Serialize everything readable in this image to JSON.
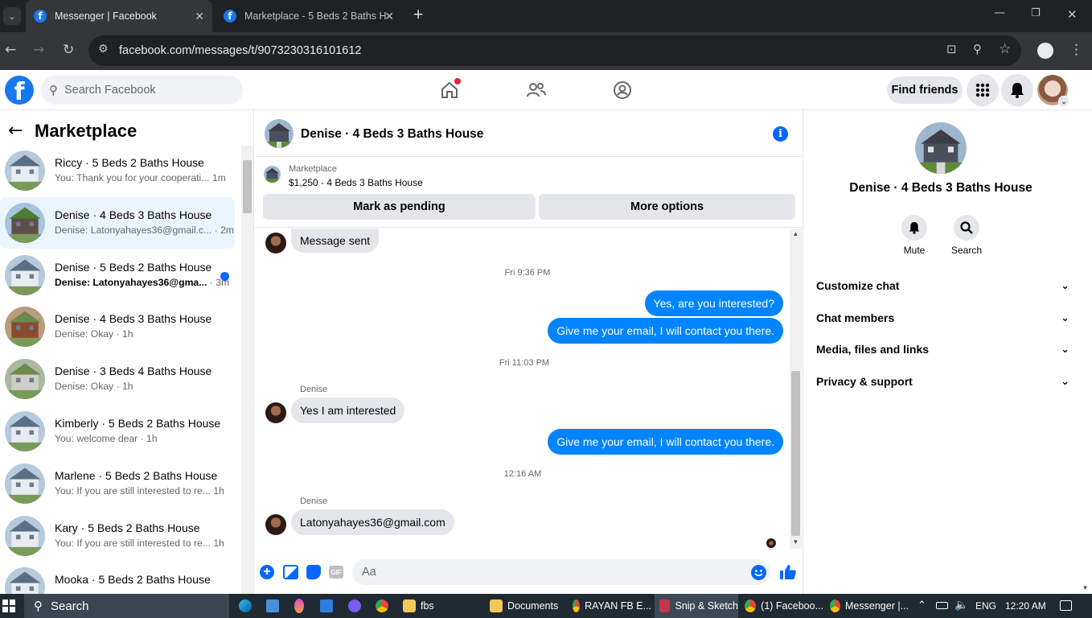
{
  "browser": {
    "tabs": [
      {
        "title": "Messenger | Facebook",
        "active": true
      },
      {
        "title": "Marketplace - 5 Beds 2 Baths H",
        "active": false
      }
    ],
    "url": "facebook.com/messages/t/9073230316101612"
  },
  "fb_header": {
    "search_placeholder": "Search Facebook",
    "find_friends": "Find friends"
  },
  "sidebar": {
    "title": "Marketplace",
    "conversations": [
      {
        "name": "Riccy · 5 Beds 2 Baths House",
        "preview": "You: Thank you for your cooperati...",
        "time": "1m",
        "unread": false,
        "selected": false
      },
      {
        "name": "Denise · 4 Beds 3 Baths House",
        "preview": "Denise: Latonyahayes36@gmail.c...",
        "time": "· 2m",
        "unread": false,
        "selected": true
      },
      {
        "name": "Denise · 5 Beds 2 Baths House",
        "preview": "Denise: Latonyahayes36@gma...",
        "time": "· 3m",
        "unread": true,
        "selected": false
      },
      {
        "name": "Denise · 4 Beds 3 Baths House",
        "preview": "Denise: Okay",
        "time": "· 1h",
        "unread": false,
        "selected": false
      },
      {
        "name": "Denise · 3 Beds 4 Baths House",
        "preview": "Denise: Okay",
        "time": "· 1h",
        "unread": false,
        "selected": false
      },
      {
        "name": "Kimberly · 5 Beds 2 Baths House",
        "preview": "You: welcome dear",
        "time": "· 1h",
        "unread": false,
        "selected": false
      },
      {
        "name": "Marlene · 5 Beds 2 Baths House",
        "preview": "You: If you are still interested to re...",
        "time": "1h",
        "unread": false,
        "selected": false
      },
      {
        "name": "Kary · 5 Beds 2 Baths House",
        "preview": "You: If you are still interested to re...",
        "time": "1h",
        "unread": false,
        "selected": false
      },
      {
        "name": "Mooka · 5 Beds 2 Baths House",
        "preview": "",
        "time": "",
        "unread": false,
        "selected": false
      }
    ]
  },
  "chat": {
    "title": "Denise · 4 Beds 3 Baths House",
    "listing": {
      "label": "Marketplace",
      "price_title": "$1,250 - 4 Beds 3 Baths House"
    },
    "actions": {
      "pending": "Mark as pending",
      "more": "More options"
    },
    "messages": {
      "m1": "Message sent",
      "ts1": "Fri 9:36 PM",
      "m2": "Yes, are you interested?",
      "m3": "Give me your email, I will contact you there.",
      "ts2": "Fri 11:03 PM",
      "sender1": "Denise",
      "m4": "Yes I am interested",
      "m5": "Give me your email, I will contact you there.",
      "ts3": "12:16 AM",
      "sender2": "Denise",
      "m6": "Latonyahayes36@gmail.com"
    },
    "composer_placeholder": "Aa",
    "gif_label": "GIF"
  },
  "details": {
    "name": "Denise · 4 Beds 3 Baths House",
    "mute": "Mute",
    "search": "Search",
    "sections": [
      "Customize chat",
      "Chat members",
      "Media, files and links",
      "Privacy & support"
    ]
  },
  "taskbar": {
    "search": "Search",
    "apps": [
      "fbs",
      "Documents",
      "RAYAN FB E...",
      "Snip & Sketch",
      "(1) Faceboo...",
      "Messenger |..."
    ],
    "lang": "ENG",
    "time": "12:20 AM"
  },
  "colors": {
    "fb_blue": "#1877f2",
    "bubble_out": "#0084ff",
    "bubble_in": "#e4e6eb"
  }
}
